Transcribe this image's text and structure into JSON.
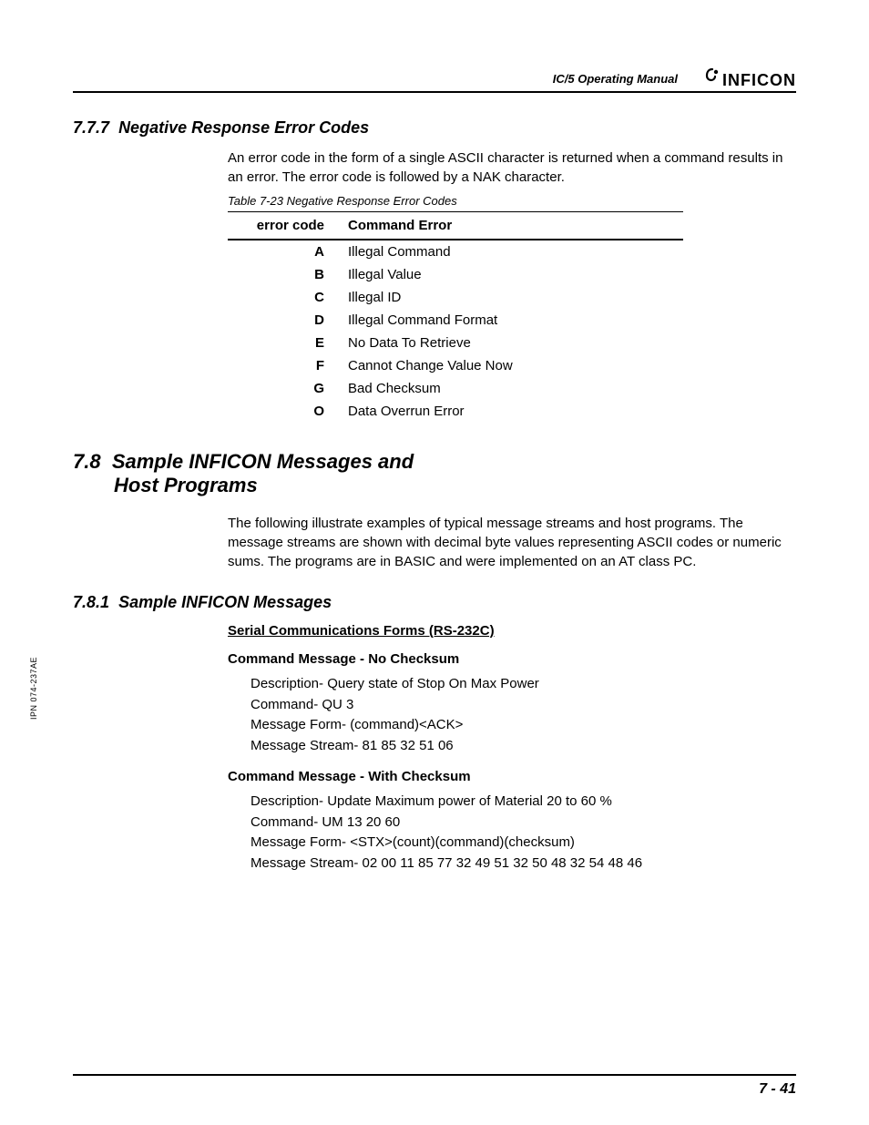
{
  "header": {
    "manual_name": "IC/5 Operating Manual",
    "logo_text": "INFICON"
  },
  "side_label": "IPN 074-237AE",
  "section_777": {
    "number": "7.7.7",
    "title": "Negative Response Error Codes",
    "para": "An error code in the form of a single ASCII character is returned when a command results in an error. The error code is followed by a NAK character.",
    "table_caption": "Table 7-23  Negative Response Error Codes",
    "col1": "error code",
    "col2": "Command Error",
    "rows": [
      {
        "code": "A",
        "err": "Illegal Command"
      },
      {
        "code": "B",
        "err": "Illegal Value"
      },
      {
        "code": "C",
        "err": "Illegal ID"
      },
      {
        "code": "D",
        "err": "Illegal Command Format"
      },
      {
        "code": "E",
        "err": "No Data To Retrieve"
      },
      {
        "code": "F",
        "err": "Cannot Change Value Now"
      },
      {
        "code": "G",
        "err": "Bad Checksum"
      },
      {
        "code": "O",
        "err": "Data Overrun Error"
      }
    ]
  },
  "section_78": {
    "number": "7.8",
    "title_l1": "Sample INFICON Messages and",
    "title_l2": "Host Programs",
    "para": "The following illustrate examples of typical message streams and host programs. The message streams are shown with decimal byte values representing ASCII codes or numeric sums. The programs are in BASIC and were implemented on an AT class PC."
  },
  "section_781": {
    "number": "7.8.1",
    "title": "Sample INFICON Messages",
    "subheading": "Serial Communications Forms (RS-232C)",
    "msg1": {
      "title": "Command Message - No Checksum",
      "l1": "Description- Query state of Stop On Max Power",
      "l2": "Command- QU 3",
      "l3": "Message Form- (command)<ACK>",
      "l4": "Message Stream- 81 85 32 51 06"
    },
    "msg2": {
      "title": "Command Message - With Checksum",
      "l1": "Description- Update Maximum power of Material 20 to 60 %",
      "l2": "Command- UM 13 20 60",
      "l3": "Message Form- <STX>(count)(command)(checksum)",
      "l4": "Message Stream- 02 00 11 85 77 32 49 51 32 50 48 32 54 48 46"
    }
  },
  "page_number": "7 - 41"
}
